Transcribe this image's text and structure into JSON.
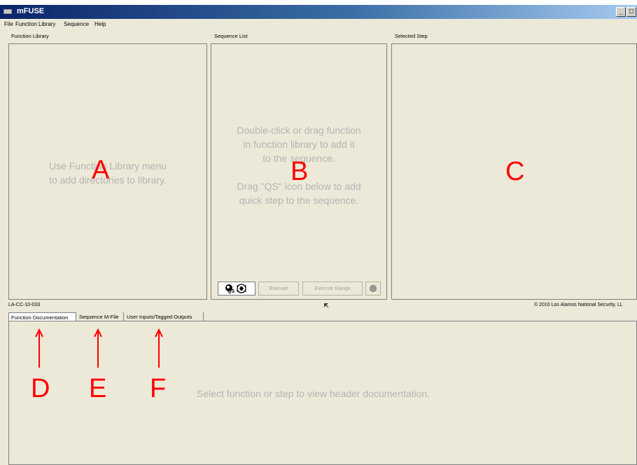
{
  "window": {
    "title": "mFUSE",
    "minimize_glyph": "_",
    "maximize_glyph": "□"
  },
  "menu": {
    "items": [
      "File",
      "Function Library",
      "Sequence",
      "Help"
    ]
  },
  "panels": {
    "library": {
      "label": "Function Library",
      "placeholder": "Use Function Library menu\nto add directories to library.",
      "marker": "A"
    },
    "sequence": {
      "label": "Sequence List",
      "placeholder": "Double-click or drag function\nin function library to add it\nto the sequence.\n\nDrag \"QS\" icon below to add\nquick step to the sequence.",
      "marker": "B",
      "qs_icon_label": "QS",
      "execute_label": "Execute",
      "execute_range_label": "Execute Range"
    },
    "selected": {
      "label": "Selected Step",
      "marker": "C"
    }
  },
  "status": {
    "id": "LA-CC-10-033",
    "copyright": "© 2010 Los Alamos National Security, LL"
  },
  "tabs": [
    {
      "label": "Function Documentation",
      "marker": "D"
    },
    {
      "label": "Sequence M-File",
      "marker": "E"
    },
    {
      "label": "User Inputs/Tagged Outputs",
      "marker": "F"
    }
  ],
  "documentation": {
    "placeholder": "Select function or step to view header documentation."
  },
  "colors": {
    "annotation": "#ff0000",
    "placeholder_text": "#b4b4b4",
    "titlebar": "#0a246a"
  },
  "icons": [
    "app-icon",
    "qs-quickstep-icon",
    "record-dot-icon",
    "resize-grip-icon"
  ]
}
